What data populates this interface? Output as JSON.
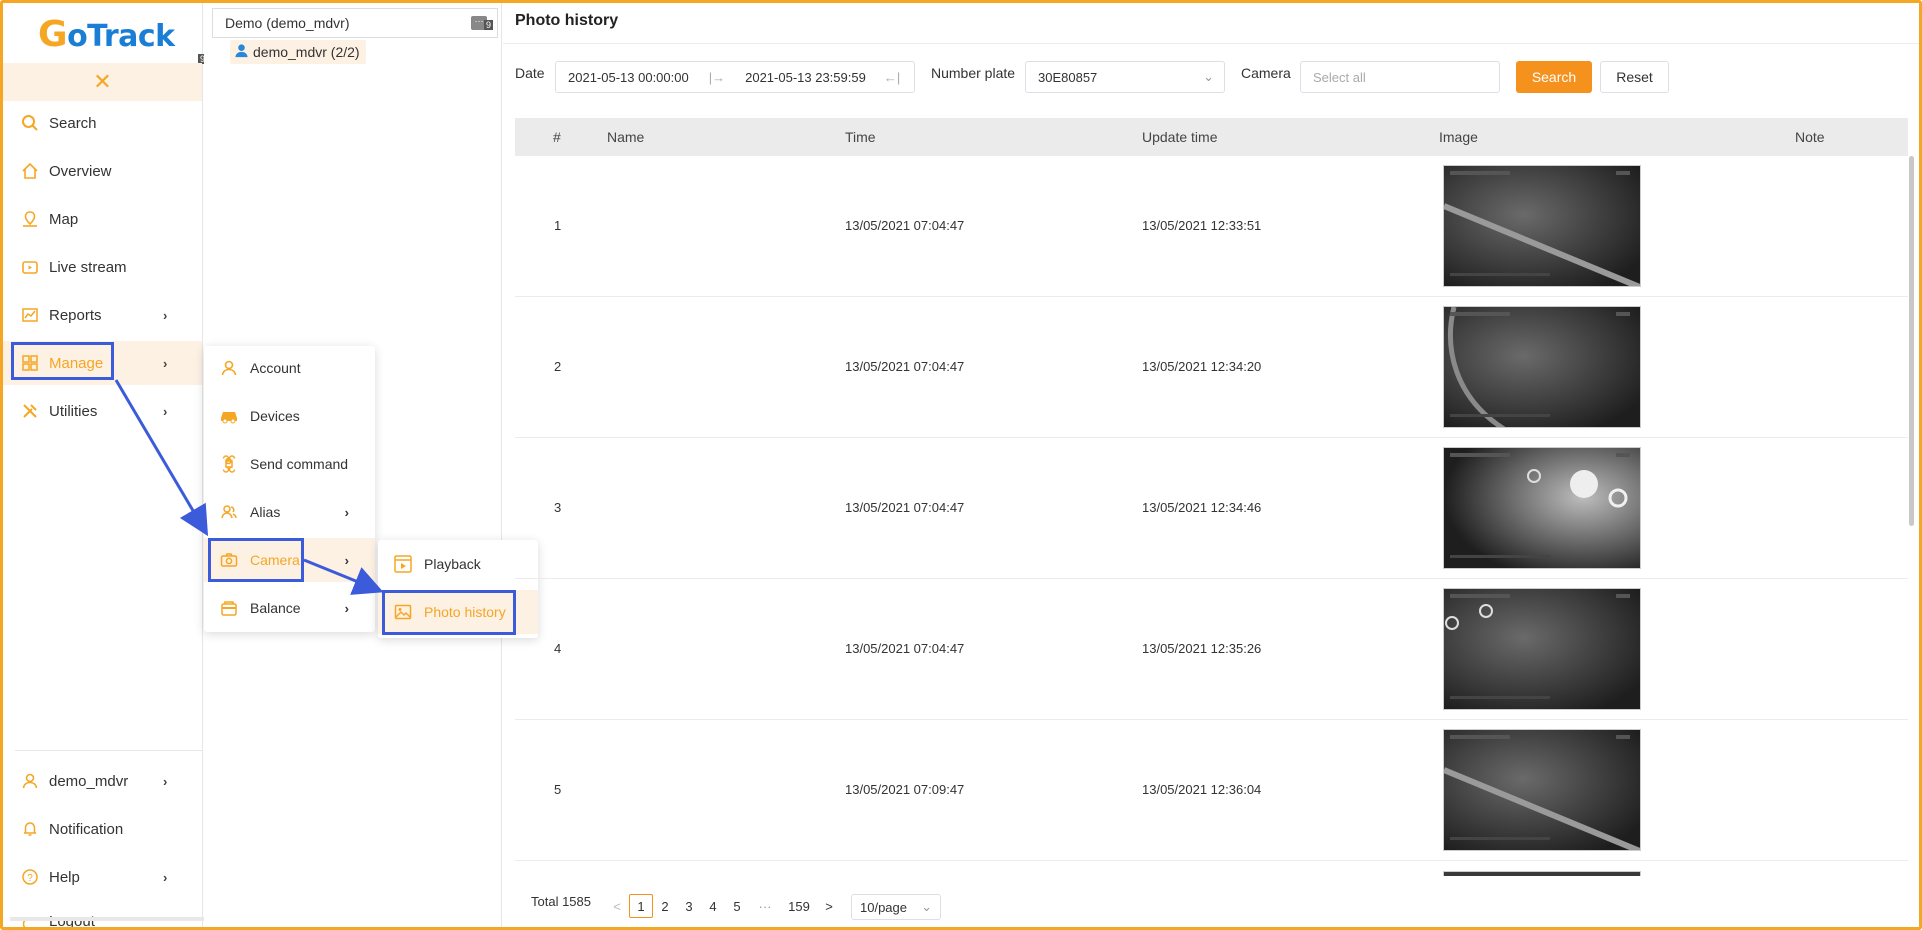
{
  "brand": {
    "name_g": "G",
    "name_rest": "oTrack",
    "collapse_tag": "9"
  },
  "sidebar": {
    "close_icon": "close-icon",
    "items": [
      {
        "label": "Search",
        "icon": "search-icon"
      },
      {
        "label": "Overview",
        "icon": "home-icon"
      },
      {
        "label": "Map",
        "icon": "map-icon"
      },
      {
        "label": "Live stream",
        "icon": "live-icon"
      },
      {
        "label": "Reports",
        "icon": "chart-icon"
      },
      {
        "label": "Manage",
        "icon": "grid-icon"
      },
      {
        "label": "Utilities",
        "icon": "tools-icon"
      }
    ],
    "bottom_items": [
      {
        "label": "demo_mdvr",
        "icon": "user-icon"
      },
      {
        "label": "Notification",
        "icon": "bell-icon"
      },
      {
        "label": "Help",
        "icon": "help-icon"
      },
      {
        "label": "Logout",
        "icon": "logout-icon"
      }
    ]
  },
  "tree": {
    "account_select": "Demo (demo_mdvr)",
    "more_tag": "9",
    "node_label": "demo_mdvr (2/2)"
  },
  "manage_menu": {
    "items": [
      {
        "label": "Account",
        "icon": "user-icon"
      },
      {
        "label": "Devices",
        "icon": "car-icon"
      },
      {
        "label": "Send command",
        "icon": "command-icon"
      },
      {
        "label": "Alias",
        "icon": "alias-icon"
      },
      {
        "label": "Camera",
        "icon": "camera-icon"
      },
      {
        "label": "Balance",
        "icon": "wallet-icon"
      }
    ]
  },
  "camera_menu": {
    "items": [
      {
        "label": "Playback",
        "icon": "playback-icon"
      },
      {
        "label": "Photo history",
        "icon": "image-icon"
      }
    ]
  },
  "main": {
    "title": "Photo history",
    "filters": {
      "date_label": "Date",
      "date_from": "2021-05-13 00:00:00",
      "date_to": "2021-05-13 23:59:59",
      "plate_label": "Number plate",
      "plate_value": "30E80857",
      "camera_label": "Camera",
      "camera_placeholder": "Select all",
      "search_label": "Search",
      "reset_label": "Reset"
    },
    "columns": [
      "#",
      "Name",
      "Time",
      "Update time",
      "Image",
      "Note"
    ],
    "rows": [
      {
        "num": "1",
        "name": "",
        "time": "13/05/2021 07:04:47",
        "update_time": "13/05/2021 12:33:51",
        "note": ""
      },
      {
        "num": "2",
        "name": "",
        "time": "13/05/2021 07:04:47",
        "update_time": "13/05/2021 12:34:20",
        "note": ""
      },
      {
        "num": "3",
        "name": "",
        "time": "13/05/2021 07:04:47",
        "update_time": "13/05/2021 12:34:46",
        "note": ""
      },
      {
        "num": "4",
        "name": "",
        "time": "13/05/2021 07:04:47",
        "update_time": "13/05/2021 12:35:26",
        "note": ""
      },
      {
        "num": "5",
        "name": "",
        "time": "13/05/2021 07:09:47",
        "update_time": "13/05/2021 12:36:04",
        "note": ""
      }
    ],
    "pagination": {
      "total": "Total 1585",
      "prev": "<",
      "pages": [
        "1",
        "2",
        "3",
        "4",
        "5"
      ],
      "ellipsis": "···",
      "last": "159",
      "next": ">",
      "size": "10/page"
    }
  },
  "colors": {
    "accent": "#f5921e",
    "highlight": "#3b5bdb",
    "active_bg": "#fdf1e4"
  }
}
